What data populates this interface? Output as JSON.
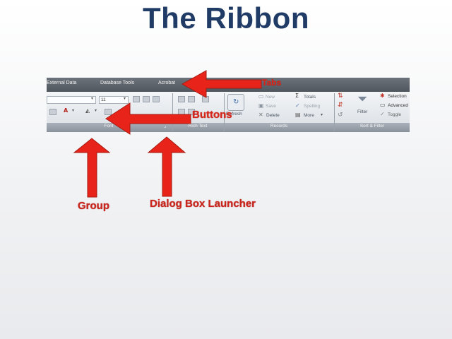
{
  "slide": {
    "title": "The Ribbon"
  },
  "ribbon": {
    "tabs": [
      "External Data",
      "Database Tools",
      "Acrobat"
    ],
    "font_size_value": "11",
    "groups": [
      "Font",
      "Rich Text",
      "Records",
      "Sort & Filter"
    ],
    "records": {
      "new": "New",
      "save": "Save",
      "delete": "Delete",
      "totals": "Totals",
      "spelling": "Spelling",
      "more": "More",
      "refresh": "Refresh"
    },
    "sort_filter": {
      "filter": "Filter",
      "selection": "Selection",
      "advanced": "Advanced",
      "toggle": "Toggle"
    }
  },
  "annotations": {
    "tabs": "Tabs",
    "buttons": "Buttons",
    "group": "Group",
    "dialog_box_launcher": "Dialog Box Launcher"
  },
  "colors": {
    "title": "#1f3b66",
    "annotation": "#d8261b"
  }
}
